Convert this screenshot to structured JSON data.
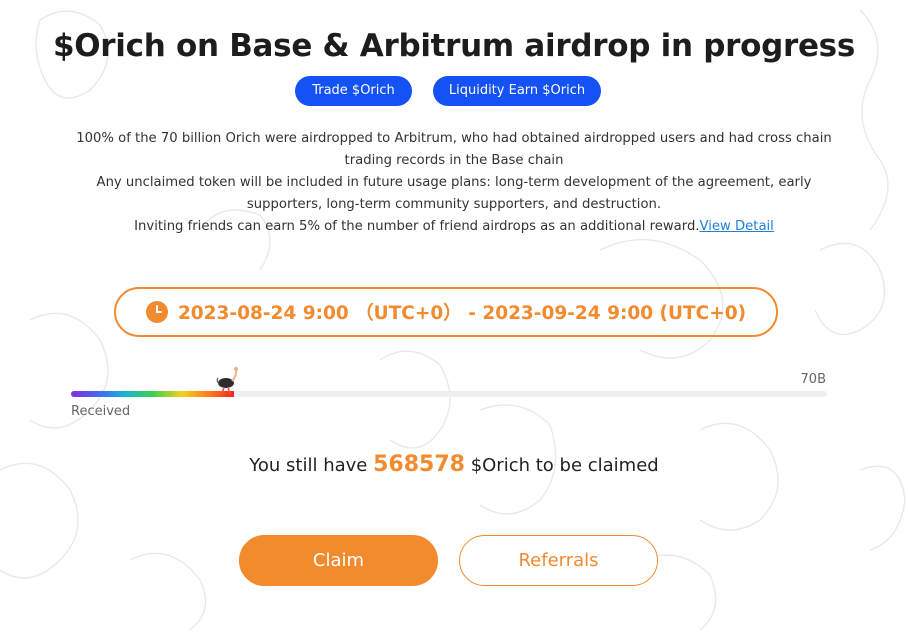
{
  "header": {
    "title": "$Orich on Base & Arbitrum airdrop in progress",
    "trade_button": "Trade $Orich",
    "liquidity_button": "Liquidity Earn $Orich"
  },
  "description": {
    "line1": "100% of the 70 billion Orich were airdropped to Arbitrum, who had obtained airdropped users and had cross chain trading records in the Base chain",
    "line2": "Any unclaimed token will be included in future usage plans: long-term development of the agreement, early supporters, long-term community supporters, and destruction.",
    "line3": "Inviting friends can earn 5% of the number of friend airdrops as an additional reward.",
    "link": "View Detail"
  },
  "period": {
    "icon": "clock-icon",
    "text": "2023-08-24 9:00 （UTC+0） - 2023-09-24 9:00 (UTC+0)"
  },
  "progress": {
    "max_label": "70B",
    "received_label": "Received",
    "fill_fraction": 0.215,
    "marker_icon": "ostrich-icon"
  },
  "claim": {
    "prefix": "You still have",
    "amount": "568578",
    "suffix": "$Orich to be claimed"
  },
  "actions": {
    "claim": "Claim",
    "referrals": "Referrals"
  },
  "colors": {
    "accent": "#f28a2e",
    "blue": "#1452f5",
    "link": "#1e7fd8"
  }
}
